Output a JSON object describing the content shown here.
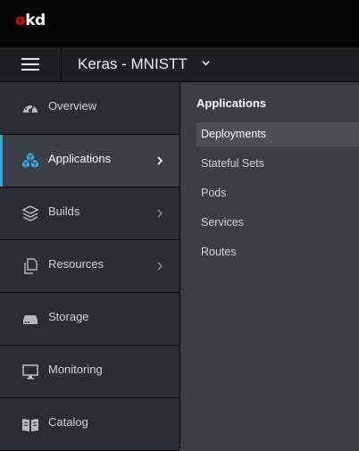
{
  "header": {
    "logo": "okd",
    "logo_o": "o",
    "logo_rest": "kd"
  },
  "project": {
    "name": "Keras - MNISTT"
  },
  "sidebar": {
    "items": [
      {
        "label": "Overview",
        "icon": "dashboard-icon"
      },
      {
        "label": "Applications",
        "icon": "cubes-icon",
        "active": true
      },
      {
        "label": "Builds",
        "icon": "layers-icon"
      },
      {
        "label": "Resources",
        "icon": "copy-icon"
      },
      {
        "label": "Storage",
        "icon": "storage-drive-icon"
      },
      {
        "label": "Monitoring",
        "icon": "monitor-icon"
      },
      {
        "label": "Catalog",
        "icon": "book-icon"
      }
    ]
  },
  "submenu": {
    "title": "Applications",
    "items": [
      {
        "label": "Deployments",
        "active": true
      },
      {
        "label": "Stateful Sets"
      },
      {
        "label": "Pods"
      },
      {
        "label": "Services"
      },
      {
        "label": "Routes"
      }
    ]
  },
  "colors": {
    "accent": "#39a5dc",
    "logo_red": "#ee0000",
    "topbar": "#030303",
    "sidebar": "#292e34",
    "panel": "#393f44"
  }
}
